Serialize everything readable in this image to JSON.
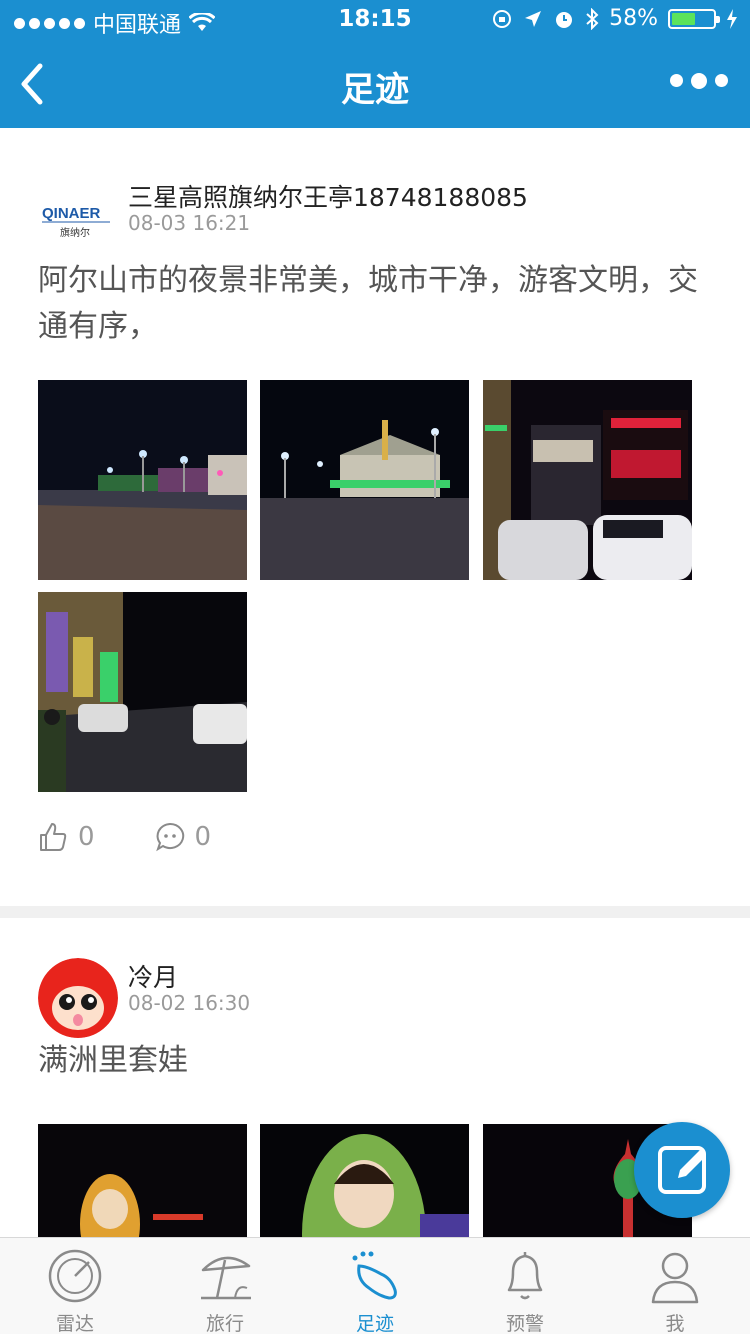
{
  "status_bar": {
    "carrier": "中国联通",
    "time": "18:15",
    "battery": "58%",
    "battery_level": 0.58
  },
  "nav": {
    "title": "足迹",
    "back_icon": "chevron-left-icon",
    "more_icon": "more-dots-icon"
  },
  "posts": [
    {
      "user": "三星高照旗纳尔王亭18748188085",
      "avatar_logo_text": "QINAER",
      "avatar_logo_subtext": "旗纳尔",
      "time": "08-03 16:21",
      "text": "阿尔山市的夜景非常美，城市干净，游客文明，交通有序，",
      "photos": [
        "night-street-photo",
        "night-square-photo",
        "night-storefront-photo",
        "night-road-photo"
      ],
      "likes": "0",
      "comments": "0"
    },
    {
      "user": "冷月",
      "time": "08-02 16:30",
      "text": "满洲里套娃",
      "photos": [
        "matryoshka-photo",
        "matryoshka-large-photo",
        "onion-dome-photo"
      ]
    }
  ],
  "tabs": [
    {
      "label": "雷达",
      "icon": "radar-icon",
      "active": false
    },
    {
      "label": "旅行",
      "icon": "beach-umbrella-icon",
      "active": false
    },
    {
      "label": "足迹",
      "icon": "footprint-icon",
      "active": true
    },
    {
      "label": "预警",
      "icon": "bell-icon",
      "active": false
    },
    {
      "label": "我",
      "icon": "user-icon",
      "active": false
    }
  ],
  "colors": {
    "accent": "#1b8fd0",
    "battery_fill": "#5be35b"
  }
}
